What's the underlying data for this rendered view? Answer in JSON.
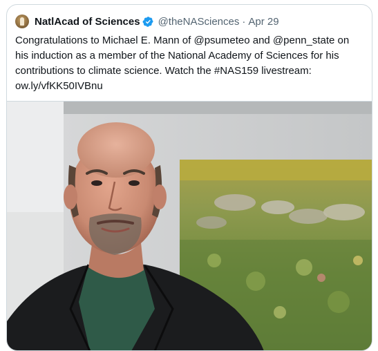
{
  "tweet": {
    "display_name": "NatlAcad of Sciences",
    "handle": "@theNASciences",
    "separator": "·",
    "date": "Apr 29",
    "text": "Congratulations to Michael E. Mann of @psumeteo and @penn_state on\nhis induction as a member of the National Academy of Sciences for his\ncontributions to climate science. Watch the #NAS159 livestream:\now.ly/vfKK50IVBnu"
  },
  "icons": {
    "avatar": "nas-logo-avatar",
    "verified": "verified-badge-icon",
    "verified_color": "#1d9bf0"
  },
  "media": {
    "description_icon": "photo"
  }
}
